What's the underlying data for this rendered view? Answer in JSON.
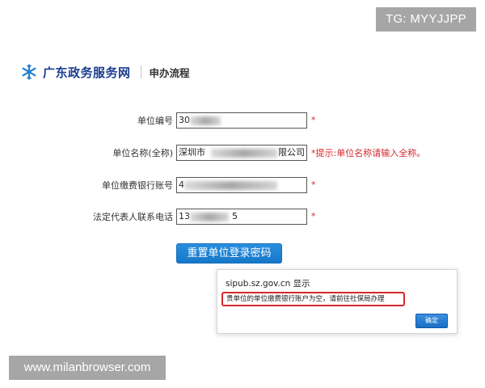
{
  "watermarks": {
    "top": "TG: MYYJJPP",
    "bottom": "www.milanbrowser.com"
  },
  "header": {
    "brand": "广东政务服务网",
    "breadcrumb": "申办流程",
    "logo_icon": "snowflake-logo-icon",
    "brand_color": "#1a3d8f"
  },
  "form": {
    "fields": [
      {
        "label": "单位编号",
        "value": "30",
        "required": "*"
      },
      {
        "label": "单位名称(全称)",
        "value": "深圳市",
        "value_tail": "限公司",
        "hint": "*提示:单位名称请输入全称。"
      },
      {
        "label": "单位缴费银行账号",
        "value": "4",
        "required": "*"
      },
      {
        "label": "法定代表人联系电话",
        "value": "13",
        "value_tail": "5",
        "required": "*"
      }
    ],
    "reset_button": "重置单位登录密码",
    "required_color": "#d9262c",
    "button_color": "#1a82d6"
  },
  "dialog": {
    "title": "sipub.sz.gov.cn 显示",
    "message": "贵单位的单位缴费银行账户为空，请前往社保局办理",
    "ok_button": "确定",
    "highlight_color": "#d9262c"
  }
}
